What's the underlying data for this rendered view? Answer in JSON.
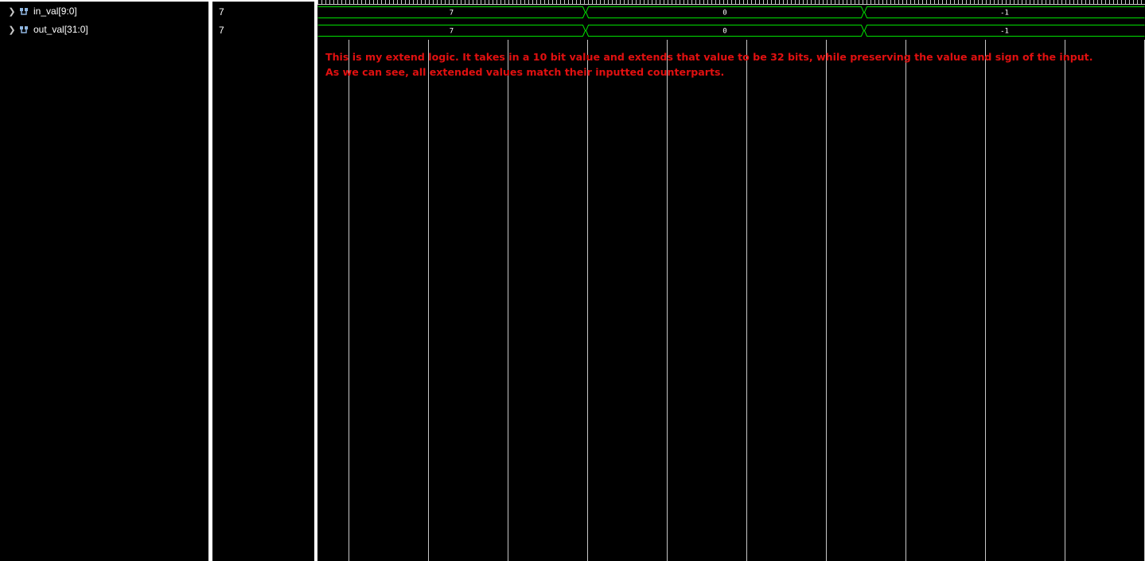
{
  "signals": [
    {
      "name": "in_val[9:0]",
      "value": "7",
      "icon": "bus-signal-icon"
    },
    {
      "name": "out_val[31:0]",
      "value": "7",
      "icon": "bus-signal-icon"
    }
  ],
  "waveforms": [
    {
      "signal": "in_val[9:0]",
      "segments": [
        {
          "label": "7",
          "start": 0,
          "end": 337
        },
        {
          "label": "0",
          "start": 337,
          "end": 687
        },
        {
          "label": "-1",
          "start": 687,
          "end": 1040
        }
      ]
    },
    {
      "signal": "out_val[31:0]",
      "segments": [
        {
          "label": "7",
          "start": 0,
          "end": 337
        },
        {
          "label": "0",
          "start": 337,
          "end": 687
        },
        {
          "label": "-1",
          "start": 687,
          "end": 1040
        }
      ]
    }
  ],
  "annotation": {
    "line1": "This is my extend logic. It takes in a 10 bit value and extends that value to be 32 bits, while preserving the value and sign of the input.",
    "line2": "As we can see, all extended values match their inputted counterparts."
  },
  "colors": {
    "background": "#000000",
    "waveform": "#00e000",
    "grid": "#c8c8c8",
    "annotation": "#e01010",
    "text": "#ffffff"
  }
}
